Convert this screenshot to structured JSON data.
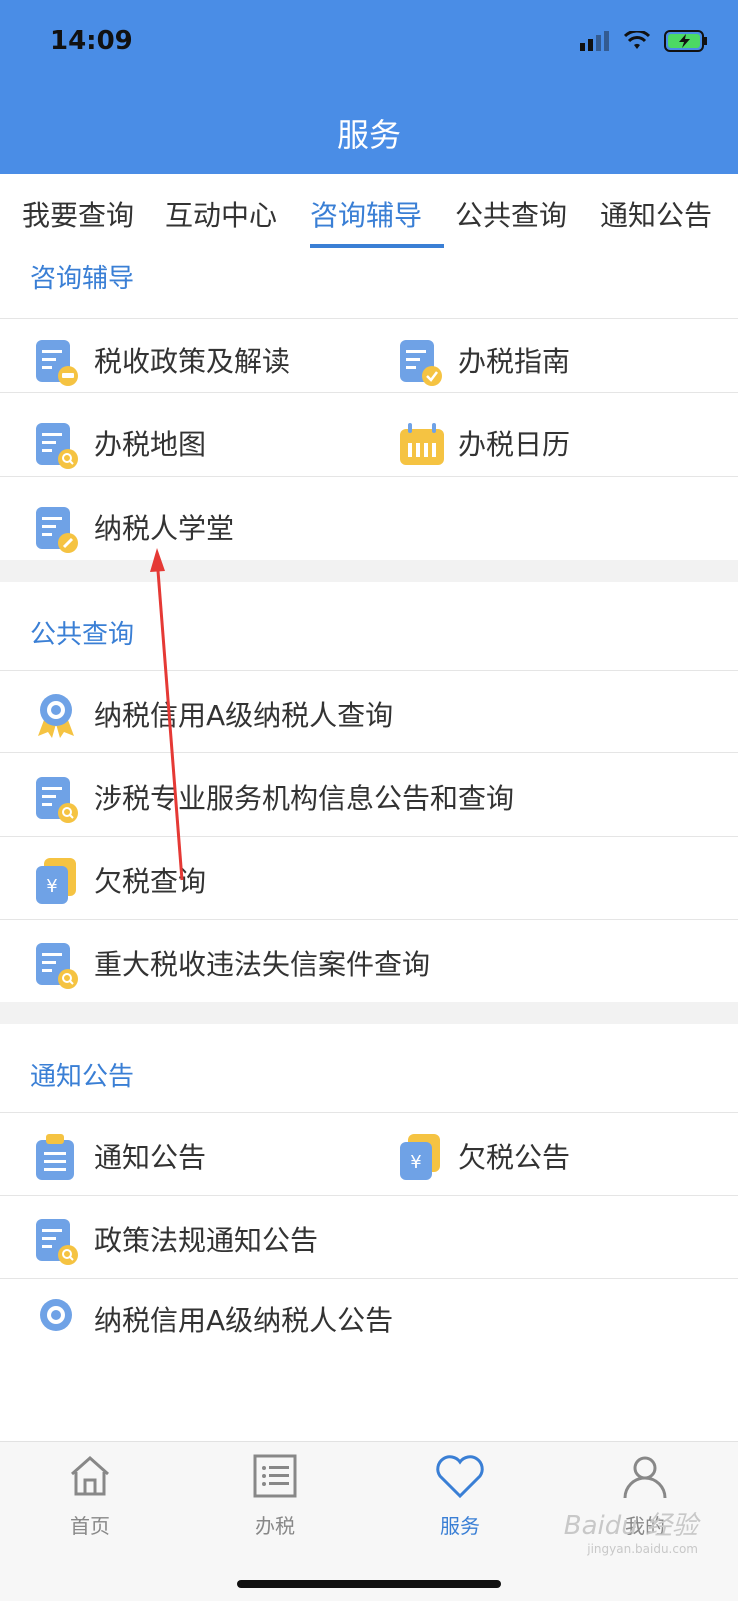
{
  "status_bar": {
    "time": "14:09"
  },
  "header": {
    "title": "服务"
  },
  "tabs": [
    {
      "label": "我要查询"
    },
    {
      "label": "互动中心"
    },
    {
      "label": "咨询辅导"
    },
    {
      "label": "公共查询"
    },
    {
      "label": "通知公告"
    }
  ],
  "active_tab": "咨询辅导",
  "sections": {
    "consult": {
      "title": "咨询辅导",
      "items": [
        {
          "label": "税收政策及解读",
          "icon": "document-car-icon"
        },
        {
          "label": "办税指南",
          "icon": "document-check-icon"
        },
        {
          "label": "办税地图",
          "icon": "document-search-icon"
        },
        {
          "label": "办税日历",
          "icon": "calendar-icon"
        },
        {
          "label": "纳税人学堂",
          "icon": "document-pen-icon"
        }
      ]
    },
    "public": {
      "title": "公共查询",
      "items": [
        {
          "label": "纳税信用A级纳税人查询",
          "icon": "award-badge-icon"
        },
        {
          "label": "涉税专业服务机构信息公告和查询",
          "icon": "document-search-icon"
        },
        {
          "label": "欠税查询",
          "icon": "yuan-card-icon"
        },
        {
          "label": "重大税收违法失信案件查询",
          "icon": "document-search-icon"
        }
      ]
    },
    "notice": {
      "title": "通知公告",
      "items": [
        {
          "label": "通知公告",
          "icon": "clipboard-icon"
        },
        {
          "label": "欠税公告",
          "icon": "yuan-card-icon"
        },
        {
          "label": "政策法规通知公告",
          "icon": "document-search-icon"
        },
        {
          "label": "纳税信用A级纳税人公告",
          "icon": "award-badge-icon"
        }
      ]
    }
  },
  "bottom_nav": [
    {
      "label": "首页",
      "icon": "home-icon"
    },
    {
      "label": "办税",
      "icon": "list-icon"
    },
    {
      "label": "服务",
      "icon": "heart-icon"
    },
    {
      "label": "我的",
      "icon": "user-icon"
    }
  ],
  "watermark": {
    "text": "Baidu 经验",
    "sub": "jingyan.baidu.com"
  },
  "colors": {
    "header": "#4a8de6",
    "accent": "#3a7fd5",
    "icon_blue": "#6fa2e6",
    "icon_yellow": "#f5c342"
  }
}
